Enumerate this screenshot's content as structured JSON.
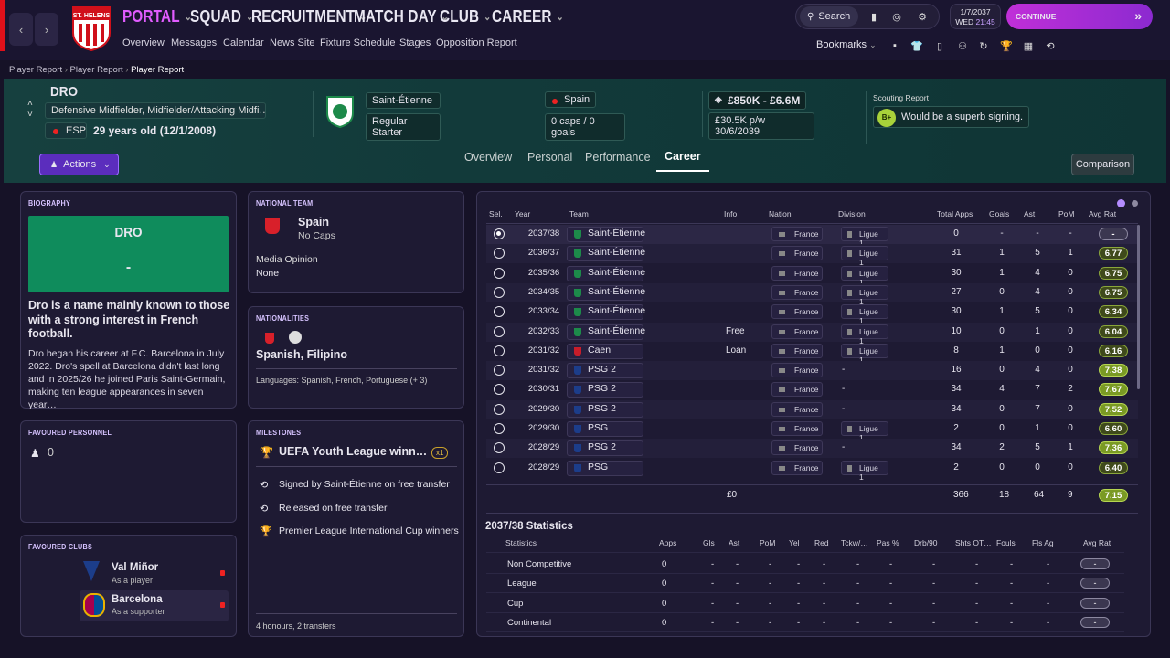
{
  "app": {
    "date": "1/7/2037",
    "weekday": "WED",
    "time": "21:45",
    "continue_label": "CONTINUE",
    "search_label": "Search",
    "bookmarks_label": "Bookmarks",
    "accent_pink": "#d63cff"
  },
  "menu": [
    {
      "label": "PORTAL",
      "active": true
    },
    {
      "label": "SQUAD"
    },
    {
      "label": "RECRUITMENT"
    },
    {
      "label": "MATCH DAY"
    },
    {
      "label": "CLUB"
    },
    {
      "label": "CAREER"
    }
  ],
  "submenu": [
    "Overview",
    "Messages",
    "Calendar",
    "News Site",
    "Fixture Schedule",
    "Stages",
    "Opposition Report"
  ],
  "club_crest_text": "ST. HELENS",
  "breadcrumb": [
    "Player Report",
    "Player Report",
    "Player Report"
  ],
  "player": {
    "name": "DRO",
    "position": "Defensive Midfielder, Midfielder/Attacking Midfi…",
    "nation_code": "ESP",
    "age": "29 years old (12/1/2008)",
    "club": "Saint-Étienne",
    "status": "Regular Starter",
    "nation": "Spain",
    "caps": "0 caps / 0 goals",
    "value": "£850K - £6.6M",
    "wage": "£30.5K p/w",
    "contract": "30/6/2039",
    "scouting_label": "Scouting Report",
    "scouting_grade": "B+",
    "scouting_text": "Would be a superb signing."
  },
  "actions_label": "Actions",
  "tabs": [
    {
      "label": "Overview"
    },
    {
      "label": "Personal"
    },
    {
      "label": "Performance"
    },
    {
      "label": "Career",
      "active": true
    }
  ],
  "comparison_label": "Comparison",
  "biography": {
    "title": "BIOGRAPHY",
    "card_name": "DRO",
    "card_value": "-",
    "headline": "Dro is a name mainly known to those with a strong interest in French football.",
    "body": "Dro began his career at F.C. Barcelona in July 2022. Dro's spell at Barcelona didn't last long and in 2025/26 he joined Paris Saint-Germain, making ten league appearances in seven year…"
  },
  "national_team": {
    "title": "NATIONAL TEAM",
    "nation": "Spain",
    "caps": "No Caps",
    "media_label": "Media Opinion",
    "media_value": "None"
  },
  "nationalities": {
    "title": "NATIONALITIES",
    "names": "Spanish, Filipino",
    "languages": "Languages: Spanish, French, Portuguese (+ 3)"
  },
  "favoured_personnel": {
    "title": "FAVOURED PERSONNEL",
    "count": "0"
  },
  "milestones": {
    "title": "MILESTONES",
    "top": "UEFA Youth League winn…",
    "top_count": "x1",
    "items": [
      "Signed by Saint-Étienne on free transfer",
      "Released on free transfer",
      "Premier League International Cup winners"
    ],
    "footer": "4 honours, 2 transfers"
  },
  "favoured_clubs": {
    "title": "FAVOURED CLUBS",
    "items": [
      {
        "name": "Val Miñor",
        "role": "As a player"
      },
      {
        "name": "Barcelona",
        "role": "As a supporter"
      }
    ]
  },
  "career_table": {
    "headers": [
      "Sel.",
      "Year",
      "Team",
      "Info",
      "Nation",
      "Division",
      "Total Apps",
      "Goals",
      "Ast",
      "PoM",
      "Avg Rat"
    ],
    "rows": [
      {
        "year": "2037/38",
        "team": "Saint-Étienne",
        "info": "",
        "nation": "France",
        "division": "Ligue 1",
        "apps": "0",
        "goals": "-",
        "ast": "-",
        "pom": "-",
        "rat": "-",
        "rating_level": "none",
        "selected": true
      },
      {
        "year": "2036/37",
        "team": "Saint-Étienne",
        "info": "",
        "nation": "France",
        "division": "Ligue 1",
        "apps": "31",
        "goals": "1",
        "ast": "5",
        "pom": "1",
        "rat": "6.77",
        "rating_level": "ok"
      },
      {
        "year": "2035/36",
        "team": "Saint-Étienne",
        "info": "",
        "nation": "France",
        "division": "Ligue 1",
        "apps": "30",
        "goals": "1",
        "ast": "4",
        "pom": "0",
        "rat": "6.75",
        "rating_level": "ok"
      },
      {
        "year": "2034/35",
        "team": "Saint-Étienne",
        "info": "",
        "nation": "France",
        "division": "Ligue 1",
        "apps": "27",
        "goals": "0",
        "ast": "4",
        "pom": "0",
        "rat": "6.75",
        "rating_level": "ok"
      },
      {
        "year": "2033/34",
        "team": "Saint-Étienne",
        "info": "",
        "nation": "France",
        "division": "Ligue 1",
        "apps": "30",
        "goals": "1",
        "ast": "5",
        "pom": "0",
        "rat": "6.34",
        "rating_level": "ok"
      },
      {
        "year": "2032/33",
        "team": "Saint-Étienne",
        "info": "Free",
        "nation": "France",
        "division": "Ligue 1",
        "apps": "10",
        "goals": "0",
        "ast": "1",
        "pom": "0",
        "rat": "6.04",
        "rating_level": "ok"
      },
      {
        "year": "2031/32",
        "team": "Caen",
        "info": "Loan",
        "nation": "France",
        "division": "Ligue 1",
        "apps": "8",
        "goals": "1",
        "ast": "0",
        "pom": "0",
        "rat": "6.16",
        "rating_level": "ok"
      },
      {
        "year": "2031/32",
        "team": "PSG 2",
        "info": "",
        "nation": "France",
        "division": "-",
        "apps": "16",
        "goals": "0",
        "ast": "4",
        "pom": "0",
        "rat": "7.38",
        "rating_level": "good"
      },
      {
        "year": "2030/31",
        "team": "PSG 2",
        "info": "",
        "nation": "France",
        "division": "-",
        "apps": "34",
        "goals": "4",
        "ast": "7",
        "pom": "2",
        "rat": "7.67",
        "rating_level": "good"
      },
      {
        "year": "2029/30",
        "team": "PSG 2",
        "info": "",
        "nation": "France",
        "division": "-",
        "apps": "34",
        "goals": "0",
        "ast": "7",
        "pom": "0",
        "rat": "7.52",
        "rating_level": "good"
      },
      {
        "year": "2029/30",
        "team": "PSG",
        "info": "",
        "nation": "France",
        "division": "Ligue 1",
        "apps": "2",
        "goals": "0",
        "ast": "1",
        "pom": "0",
        "rat": "6.60",
        "rating_level": "ok"
      },
      {
        "year": "2028/29",
        "team": "PSG 2",
        "info": "",
        "nation": "France",
        "division": "-",
        "apps": "34",
        "goals": "2",
        "ast": "5",
        "pom": "1",
        "rat": "7.36",
        "rating_level": "good"
      },
      {
        "year": "2028/29",
        "team": "PSG",
        "info": "",
        "nation": "France",
        "division": "Ligue 1",
        "apps": "2",
        "goals": "0",
        "ast": "0",
        "pom": "0",
        "rat": "6.40",
        "rating_level": "ok"
      }
    ],
    "totals": {
      "info": "£0",
      "apps": "366",
      "goals": "18",
      "ast": "64",
      "pom": "9",
      "rat": "7.15",
      "rating_level": "good"
    }
  },
  "stats": {
    "title": "2037/38 Statistics",
    "headers": [
      "Statistics",
      "Apps",
      "Gls",
      "Ast",
      "PoM",
      "Yel",
      "Red",
      "Tckw/…",
      "Pas %",
      "Drb/90",
      "Shts OT…",
      "Fouls",
      "Fls Ag",
      "Avg Rat"
    ],
    "rows": [
      {
        "label": "Non Competitive",
        "apps": "0",
        "rat": "-"
      },
      {
        "label": "League",
        "apps": "0",
        "rat": "-"
      },
      {
        "label": "Cup",
        "apps": "0",
        "rat": "-"
      },
      {
        "label": "Continental",
        "apps": "0",
        "rat": "-"
      }
    ]
  }
}
